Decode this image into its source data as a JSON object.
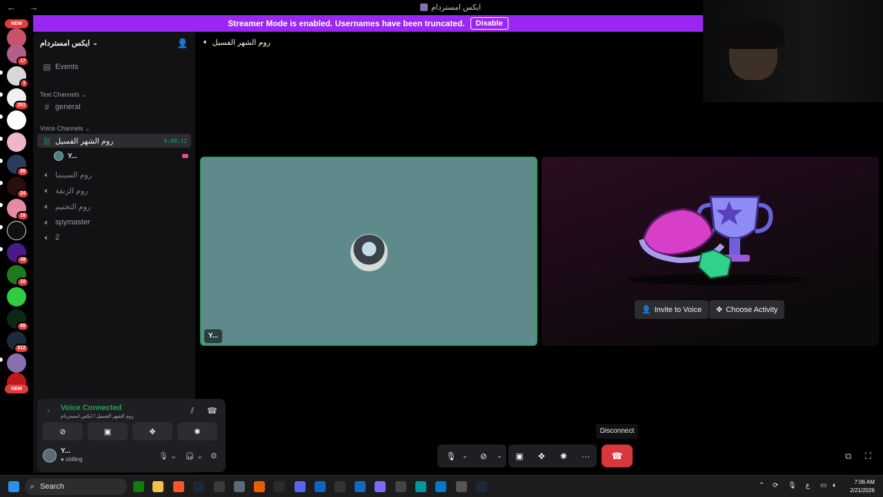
{
  "window": {
    "title": "ايكس امستردام",
    "nav_glyphs": "← →"
  },
  "banner": {
    "text": "Streamer Mode is enabled. Usernames have been truncated.",
    "button": "Disable"
  },
  "rail": {
    "new_top": "NEW",
    "new_bottom": "NEW",
    "badges": [
      "17",
      "1",
      "351",
      "85",
      "24",
      "16",
      "49",
      "10",
      "65",
      "512"
    ]
  },
  "sidebar": {
    "guild_name": "ايكس امستردام",
    "events": "Events",
    "text_category": "Text Channels",
    "text_channels": [
      "general"
    ],
    "voice_category": "Voice Channels",
    "active_channel": "روم الشهر الفسيل",
    "active_timer": "4:49:12",
    "member_name": "Y...",
    "voice_channels": [
      "روم السينما",
      "روم الزنقة",
      "روم التختيم",
      "spymaster",
      "2"
    ]
  },
  "voice_panel": {
    "status": "Voice Connected",
    "location": "روم الشهر الفسيل / ايكس امستردام",
    "user_name": "Y...",
    "user_status": "chilling"
  },
  "main": {
    "channel_title": "روم الشهر الفسيل",
    "tile_name": "Y...",
    "invite_button": "Invite to Voice",
    "activity_button": "Choose Activity"
  },
  "controls": {
    "tooltip": "Disconnect"
  },
  "taskbar": {
    "search": "Search",
    "time": "7:06 AM",
    "date": "2/21/2026",
    "lang": "ع"
  },
  "colors": {
    "banner": "#9b27f5",
    "connected": "#23a55a",
    "disconnect": "#da373c",
    "tile_bg": "#5e8a8b"
  }
}
